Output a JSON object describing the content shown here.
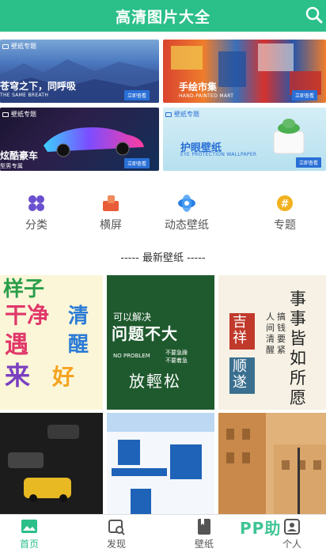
{
  "header": {
    "title": "高清图片大全",
    "search_icon": "search-icon"
  },
  "banners": [
    {
      "tag": "壁纸专题",
      "main": "苍穹之下，同呼吸",
      "sub": "THE SAME BREATH",
      "button": "立即查看"
    },
    {
      "main": "手绘市集",
      "sub": "HAND-PAINTED MART",
      "button": "立即查看"
    },
    {
      "tag": "壁纸专题",
      "main": "炫酷豪车",
      "sub": "型男专属",
      "button": "立即查看"
    },
    {
      "tag": "壁纸专题",
      "main": "护眼壁纸",
      "sub": "EYE PROTECTION WALLPAPER",
      "button": "立即查看"
    }
  ],
  "categories": [
    {
      "label": "分类",
      "icon": "grid-icon",
      "color": "#6a4fcf"
    },
    {
      "label": "横屏",
      "icon": "landscape-icon",
      "color": "#e85c3a"
    },
    {
      "label": "动态壁纸",
      "icon": "dynamic-wallpaper-icon",
      "color": "#2b7de0"
    },
    {
      "label": "专题",
      "icon": "topic-icon",
      "color": "#f2b21f"
    }
  ],
  "section_title": "----- 最新壁纸 -----",
  "wallpapers": [
    {
      "lines": [
        "样子",
        "干净",
        "清",
        "醒",
        "遇",
        "来",
        "好"
      ]
    },
    {
      "lines": [
        "可以解决",
        "问题不大",
        "NO PROBLEM",
        "不要急躁",
        "不要着急",
        "放輕松"
      ]
    },
    {
      "lines": [
        "事事皆如所愿",
        "吉祥",
        "顺遂",
        "人间清醒",
        "搞钱要紧"
      ]
    },
    {
      "lines": []
    },
    {
      "lines": []
    },
    {
      "lines": []
    }
  ],
  "tabbar": [
    {
      "label": "首页",
      "icon": "home-image-icon",
      "active": true
    },
    {
      "label": "发现",
      "icon": "discover-icon",
      "active": false
    },
    {
      "label": "壁纸",
      "icon": "wallpaper-icon",
      "active": false
    },
    {
      "label": "个人",
      "icon": "profile-icon",
      "active": false
    }
  ],
  "watermark": "PP助",
  "colors": {
    "brand": "#2bbf8a",
    "active_tab": "#2bbf8a"
  }
}
